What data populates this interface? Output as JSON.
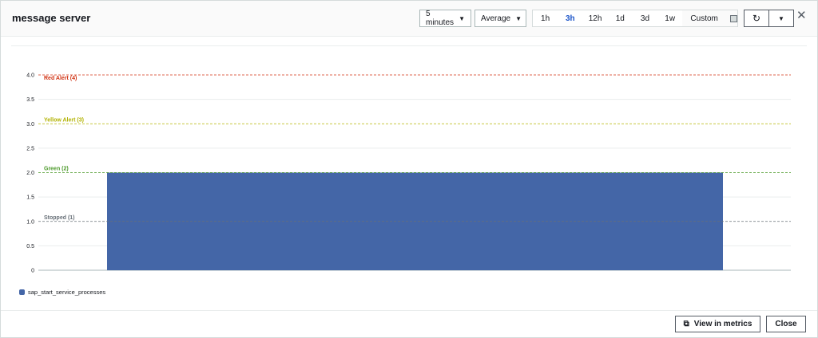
{
  "header": {
    "title": "message server"
  },
  "controls": {
    "period": "5 minutes",
    "statistic": "Average",
    "ranges": [
      "1h",
      "3h",
      "12h",
      "1d",
      "3d",
      "1w"
    ],
    "active_range": "3h",
    "custom": "Custom"
  },
  "footer": {
    "view_in_metrics": "View in metrics",
    "close": "Close"
  },
  "colors": {
    "bar": "#4466a7",
    "red": "#d13212",
    "yellow": "#b2b200",
    "green": "#4c9a2a",
    "stopped": "#687078"
  },
  "chart_data": {
    "type": "bar",
    "title": "",
    "categories": [
      ""
    ],
    "series": [
      {
        "name": "sap_start_service_processes",
        "values": [
          2
        ]
      }
    ],
    "ylim": [
      0,
      4
    ],
    "yticks": [
      "0",
      "0.5",
      "1.0",
      "1.5",
      "2.0",
      "2.5",
      "3.0",
      "3.5",
      "4.0"
    ],
    "thresholds": [
      {
        "label": "Red Alert (4)",
        "value": 4,
        "color": "#d13212"
      },
      {
        "label": "Yellow Alert (3)",
        "value": 3,
        "color": "#b2b200"
      },
      {
        "label": "Green (2)",
        "value": 2,
        "color": "#4c9a2a"
      },
      {
        "label": "Stopped (1)",
        "value": 1,
        "color": "#687078"
      }
    ],
    "legend": "bottom-left"
  }
}
